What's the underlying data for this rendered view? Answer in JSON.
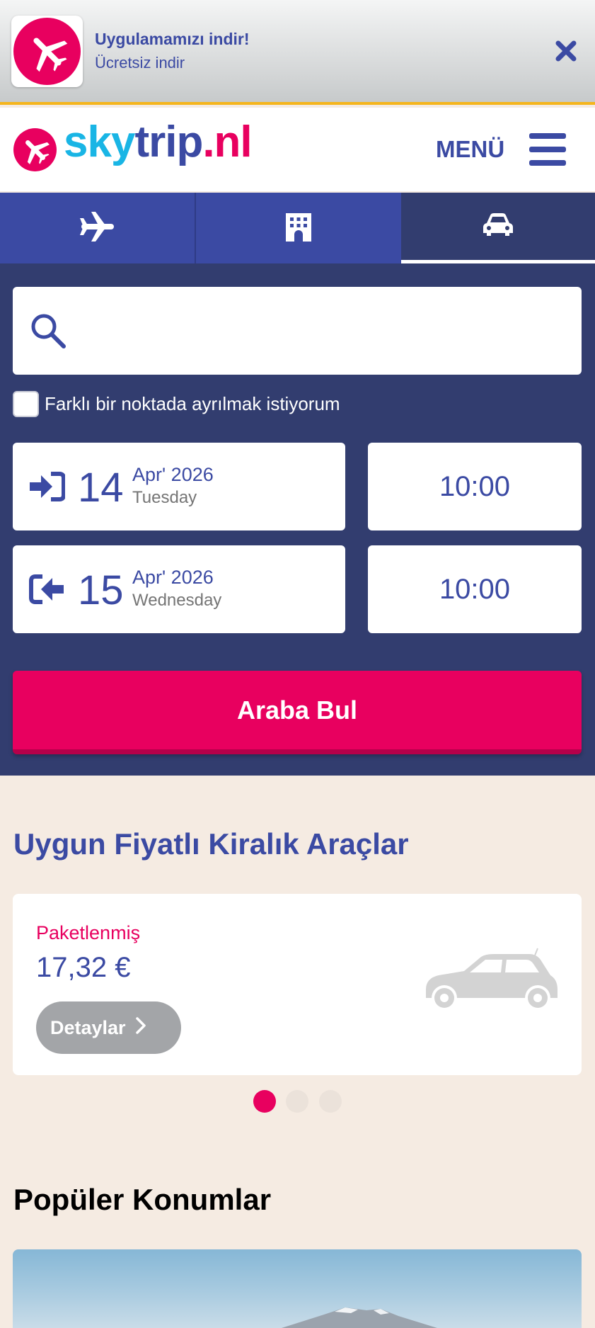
{
  "app_banner": {
    "title": "Uygulamamızı indir!",
    "subtitle": "Ücretsiz indir"
  },
  "header": {
    "logo": {
      "part1": "sky",
      "part2": "trip",
      "part3": ".nl"
    },
    "menu_label": "MENÜ"
  },
  "tabs": [
    {
      "icon": "airplane-icon",
      "active": false
    },
    {
      "icon": "hotel-icon",
      "active": false
    },
    {
      "icon": "car-icon",
      "active": true
    }
  ],
  "search": {
    "location_placeholder": "",
    "different_dropoff_label": "Farklı bir noktada ayrılmak istiyorum",
    "pickup": {
      "day": "14",
      "month_year": "Apr' 2026",
      "weekday": "Tuesday",
      "time": "10:00"
    },
    "dropoff": {
      "day": "15",
      "month_year": "Apr' 2026",
      "weekday": "Wednesday",
      "time": "10:00"
    },
    "submit_label": "Araba Bul"
  },
  "deals": {
    "title": "Uygun Fiyatlı Kiralık Araçlar",
    "card": {
      "category": "Paketlenmiş",
      "price": "17,32 €",
      "button_label": "Detaylar"
    },
    "carousel": {
      "total": 3,
      "active_index": 0
    }
  },
  "popular": {
    "title": "Popüler Konumlar"
  },
  "colors": {
    "brand_blue": "#3b4aa3",
    "brand_pink": "#e8005f",
    "brand_cyan": "#19b5e5",
    "panel_navy": "#323d6f",
    "page_bg": "#f5ebe2"
  }
}
